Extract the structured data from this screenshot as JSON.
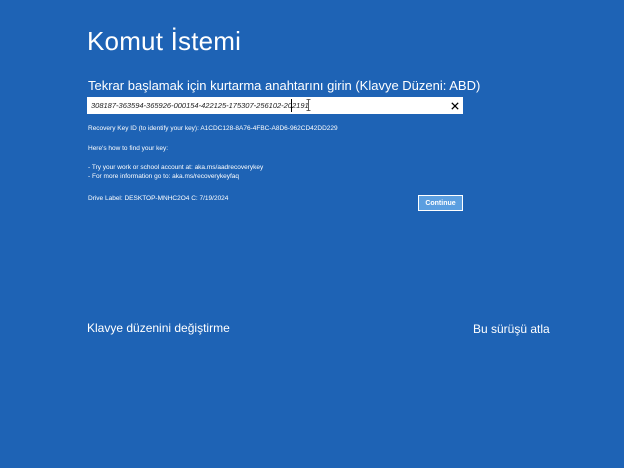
{
  "title": "Komut İstemi",
  "prompt": "Tekrar başlamak için kurtarma anahtarını girin (Klavye Düzeni: ABD)",
  "key_input": {
    "value": "308187-363594-365926-000154-422125-175307-256102-202191"
  },
  "recovery_key_id": "Recovery Key ID (to identify your key): A1CDC128-8A76-4FBC-A8D6-962CD42DD229",
  "help_heading": "Here's how to find your key:",
  "help_items": [
    "- Try your work or school account at: aka.ms/aadrecoverykey",
    "- For more information go to: aka.ms/recoverykeyfaq"
  ],
  "drive_label": "Drive Label: DESKTOP-MNHC2O4 C: 7/19/2024",
  "continue_label": "Continue",
  "change_keyboard_label": "Klavye düzenini değiştirme",
  "skip_drive_label": "Bu sürüşü atla",
  "colors": {
    "background": "#1e63b5",
    "button": "#5a9ee0"
  },
  "icons": {
    "clear": "close-icon",
    "cursor": "text-cursor-icon"
  }
}
